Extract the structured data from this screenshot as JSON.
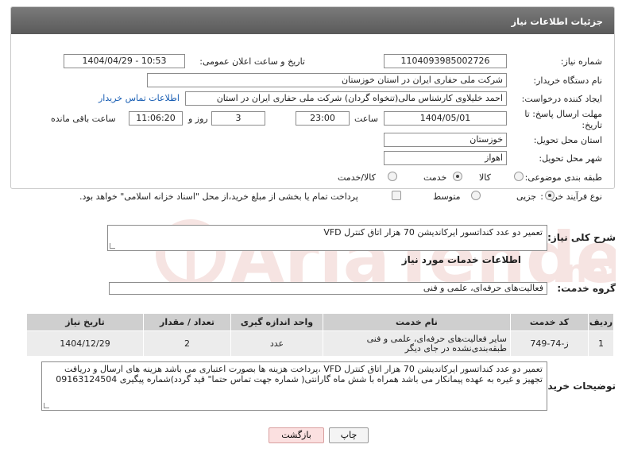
{
  "header": {
    "title": "جزئیات اطلاعات نیاز"
  },
  "fields": {
    "need_number": {
      "label": "شماره نیاز:",
      "value": "1104093985002726"
    },
    "announce": {
      "label": "تاریخ و ساعت اعلان عمومی:",
      "value": "1404/04/29 - 10:53"
    },
    "buyer": {
      "label": "نام دستگاه خریدار:",
      "value": "شرکت ملی حفاری ایران در استان خوزستان"
    },
    "creator": {
      "label": "ایجاد کننده درخواست:",
      "value": "احمد خلیلاوی کارشناس مالی(تنخواه گردان) شرکت ملی حفاری ایران در استان",
      "contact_link": "اطلاعات تماس خریدار"
    },
    "deadline": {
      "label_line1": "مهلت ارسال پاسخ: تا",
      "label_line2": "تاریخ:",
      "date": "1404/05/01",
      "time_label": "ساعت",
      "time": "23:00",
      "days": "3",
      "days_label": "روز و",
      "remaining": "11:06:20",
      "remaining_label": "ساعت باقی مانده"
    },
    "province": {
      "label": "استان محل تحویل:",
      "value": "خوزستان"
    },
    "city": {
      "label": "شهر محل تحویل:",
      "value": "اهواز"
    },
    "category": {
      "label": "طبقه بندی موضوعی:",
      "options": [
        "کالا",
        "خدمت",
        "کالا/خدمت"
      ],
      "selected": "خدمت"
    },
    "process": {
      "label": "نوع فرآیند خرید :",
      "options": [
        "جزیی",
        "متوسط"
      ],
      "selected": "جزیی",
      "note": "پرداخت تمام یا بخشی از مبلغ خرید،از محل \"اسناد خزانه اسلامی\" خواهد بود."
    }
  },
  "summary": {
    "label": "شرح کلی نیاز:",
    "value": "تعمیر دو عدد کنداتسور ایرکاندیشن 70 هزار اتاق کنترل VFD"
  },
  "services_title": "اطلاعات خدمات مورد نیاز",
  "service_group": {
    "label": "گروه خدمت:",
    "value": "فعالیت‌های حرفه‌ای، علمی و فنی"
  },
  "table": {
    "headers": [
      "ردیف",
      "کد خدمت",
      "نام خدمت",
      "واحد اندازه گیری",
      "تعداد / مقدار",
      "تاریخ نیاز"
    ],
    "rows": [
      [
        "1",
        "ز-74-749",
        "سایر فعالیت‌های حرفه‌ای، علمی و فنی طبقه‌بندی‌نشده در جای دیگر",
        "عدد",
        "2",
        "1404/12/29"
      ]
    ]
  },
  "buyer_notes": {
    "label": "توضیحات خریدار:",
    "value": "تعمیر دو عدد کنداتسور ایرکاندیشن 70 هزار اتاق کنترل VFD ،پرداخت هزینه ها بصورت اعتباری می باشد هزینه های ارسال و دریافت تجهیز و غیره به عهده پیمانکار می باشد همراه با شش ماه گارانتی( شماره جهت تماس حتما\" قید گردد)شماره پیگیری 09163124504"
  },
  "buttons": {
    "print": "چاپ",
    "back": "بازگشت"
  },
  "colors": {
    "header_bg": "#6b6b6b",
    "link": "#1a5fb4",
    "watermark": "#c0392b"
  }
}
